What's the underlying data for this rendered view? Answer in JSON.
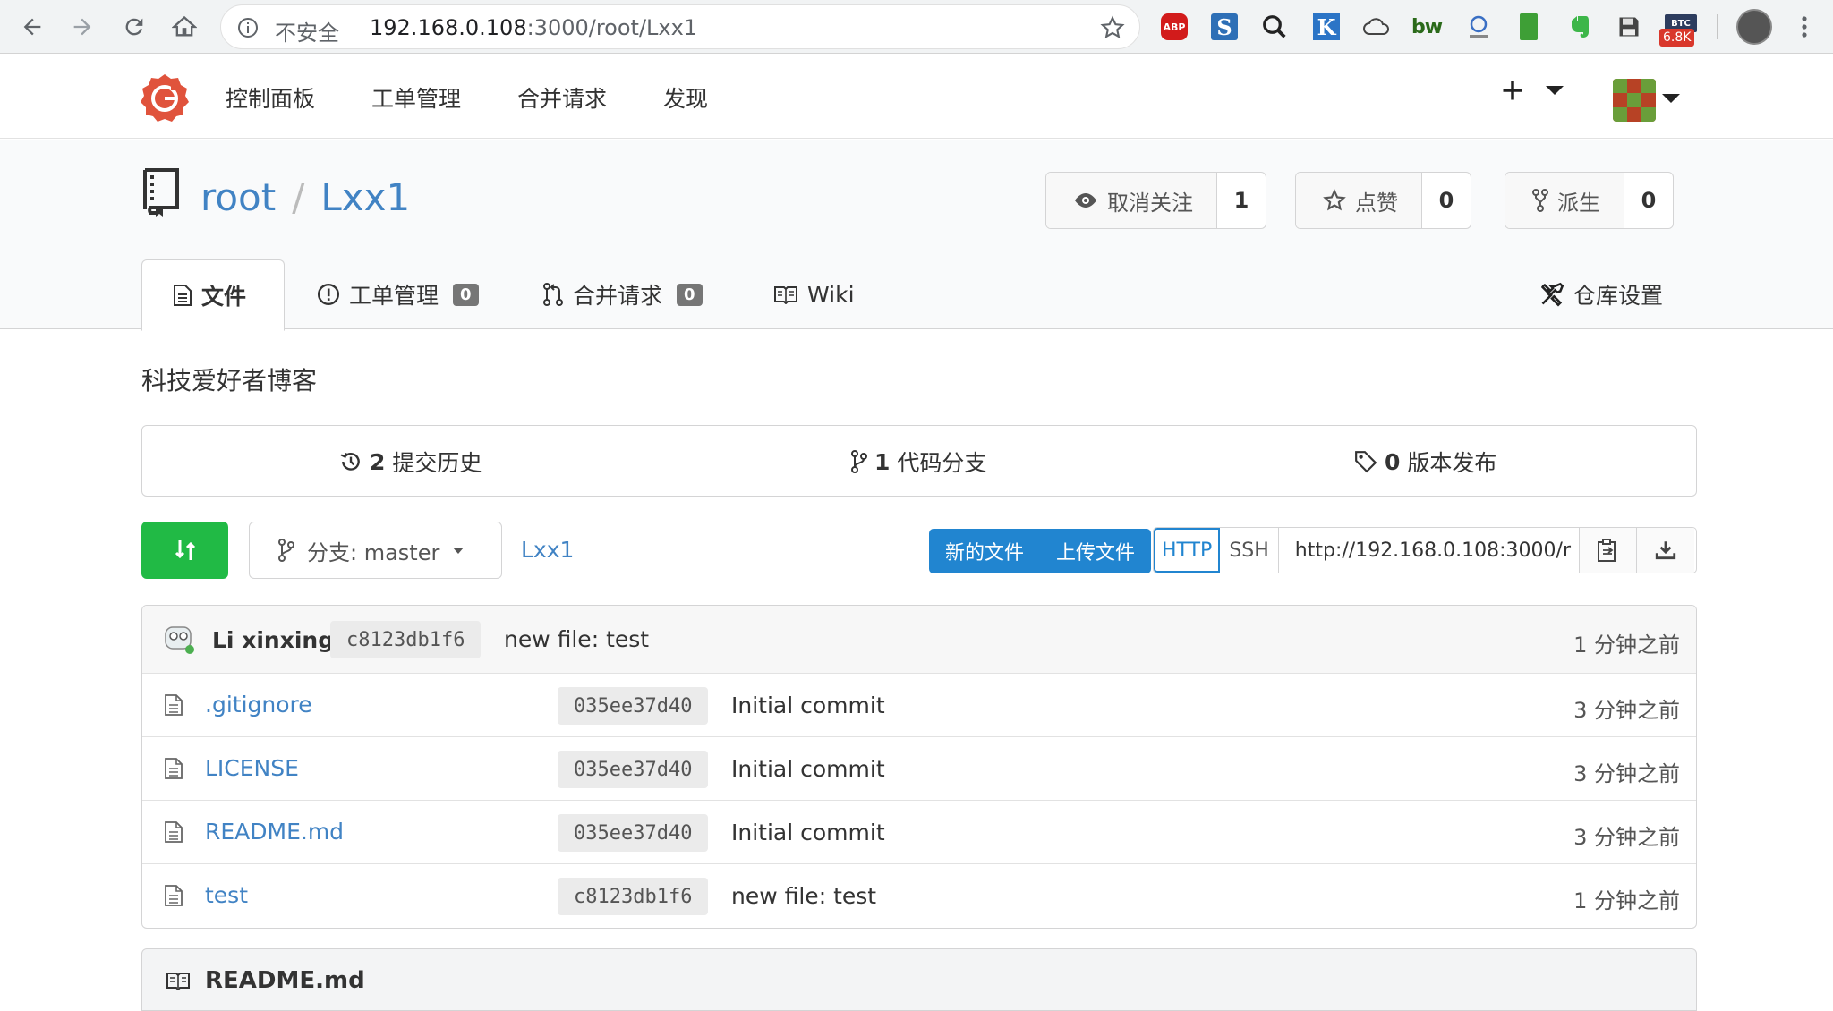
{
  "browser": {
    "insecure_label": "不安全",
    "url_host": "192.168.0.108",
    "url_rest": ":3000/root/Lxx1",
    "btc_ext_label": "BTC",
    "btc_badge": "6.8K",
    "abp_label": "ABP",
    "s_label": "S",
    "k_label": "K",
    "bw_label": "bw"
  },
  "top_nav": {
    "items": [
      "控制面板",
      "工单管理",
      "合并请求",
      "发现"
    ]
  },
  "repo": {
    "owner": "root",
    "slash": "/",
    "name": "Lxx1",
    "watch_label": "取消关注",
    "watch_count": "1",
    "star_label": "点赞",
    "star_count": "0",
    "fork_label": "派生",
    "fork_count": "0",
    "tabs": {
      "files": "文件",
      "issues": "工单管理",
      "issues_count": "0",
      "pulls": "合并请求",
      "pulls_count": "0",
      "wiki": "Wiki",
      "settings": "仓库设置"
    },
    "description": "科技爱好者博客"
  },
  "stats": {
    "commits_count": "2",
    "commits_label": "提交历史",
    "branches_count": "1",
    "branches_label": "代码分支",
    "releases_count": "0",
    "releases_label": "版本发布"
  },
  "toolbar": {
    "branch_label": "分支: master",
    "repo_crumb": "Lxx1",
    "new_file": "新的文件",
    "upload_file": "上传文件",
    "http": "HTTP",
    "ssh": "SSH",
    "clone_url": "http://192.168.0.108:3000/r"
  },
  "latest_commit": {
    "author": "Li xinxing",
    "sha": "c8123db1f6",
    "message": "new file: test",
    "when": "1 分钟之前"
  },
  "files": [
    {
      "name": ".gitignore",
      "sha": "035ee37d40",
      "message": "Initial commit",
      "when": "3 分钟之前"
    },
    {
      "name": "LICENSE",
      "sha": "035ee37d40",
      "message": "Initial commit",
      "when": "3 分钟之前"
    },
    {
      "name": "README.md",
      "sha": "035ee37d40",
      "message": "Initial commit",
      "when": "3 分钟之前"
    },
    {
      "name": "test",
      "sha": "c8123db1f6",
      "message": "new file: test",
      "when": "1 分钟之前"
    }
  ],
  "readme": {
    "title": "README.md"
  },
  "colors": {
    "link": "#4183c4",
    "green": "#21ba45",
    "blue": "#2185d0",
    "logo": "#e0533c"
  }
}
